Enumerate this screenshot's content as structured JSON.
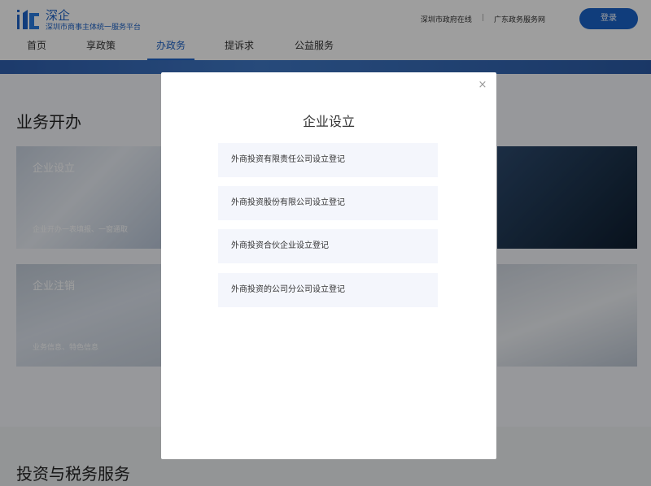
{
  "header": {
    "logo_name": "深企",
    "logo_sub": "深圳市商事主体统一服务平台",
    "top_links": [
      "深圳市政府在线",
      "广东政务服务网"
    ],
    "login_label": "登录"
  },
  "nav": [
    "首页",
    "享政策",
    "办政务",
    "提诉求",
    "公益服务"
  ],
  "main": {
    "section_title": "业务开办",
    "cards": [
      {
        "title": "企业设立",
        "desc": "企业开办一表填报、一窗通取"
      },
      {
        "title": "企业注销",
        "desc": "业务信息、特色信息"
      }
    ],
    "section_title_2": "投资与税务服务"
  },
  "modal": {
    "close": "×",
    "title": "企业设立",
    "options": [
      "外商投资有限责任公司设立登记",
      "外商投资股份有限公司设立登记",
      "外商投资合伙企业设立登记",
      "外商投资的公司分公司设立登记"
    ]
  },
  "colors": {
    "brand": "#1d63c8",
    "overlay": "rgba(0,0,0,0.38)"
  }
}
